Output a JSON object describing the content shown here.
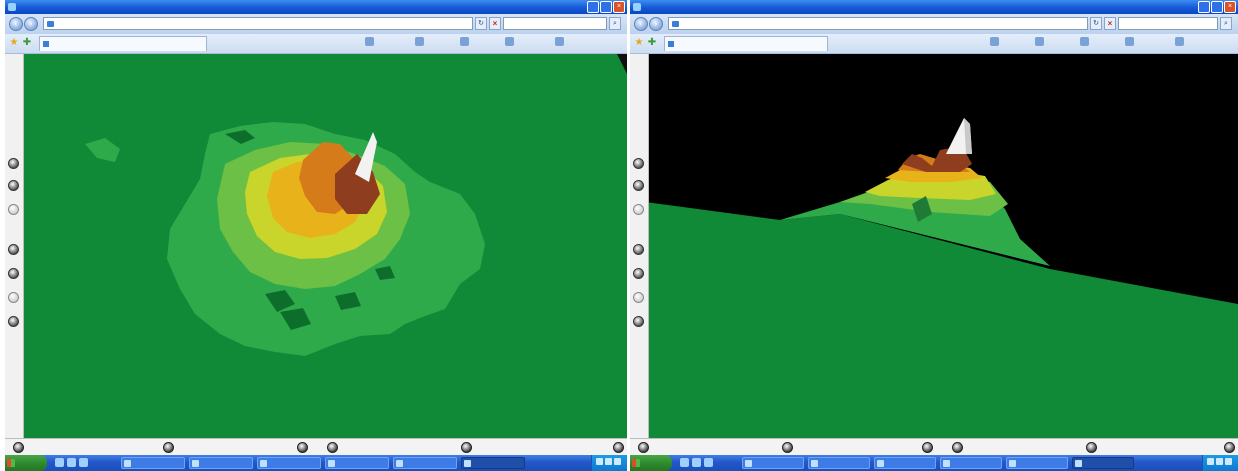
{
  "colors": {
    "terrain_base": "#118a37",
    "sky": "#000000",
    "band_1": "#2faa4a",
    "band_2": "#6cc045",
    "band_3": "#c9d52a",
    "band_4": "#e8b21b",
    "band_5": "#d67b1a",
    "peak_brown": "#8e3e1f",
    "peak_snow": "#f2f2f2",
    "xp_blue": "#245edc",
    "xp_green": "#3c9a3c"
  },
  "windows": [
    {
      "id": "left",
      "title": "",
      "address": "",
      "search_placeholder": "",
      "tab_label": "",
      "toolbar": {
        "favorites_label": "",
        "home_label": "",
        "page_label": "",
        "tools_label": ""
      },
      "view": "top-down terrain elevation view",
      "side_controls": [
        "",
        "",
        "",
        "",
        "",
        "",
        "",
        ""
      ],
      "bottom_labels": [
        "",
        "",
        "",
        ""
      ]
    },
    {
      "id": "right",
      "title": "",
      "address": "",
      "search_placeholder": "",
      "tab_label": "",
      "toolbar": {
        "favorites_label": "",
        "home_label": "",
        "page_label": "",
        "tools_label": ""
      },
      "view": "side terrain profile view",
      "side_controls": [
        "",
        "",
        "",
        "",
        "",
        "",
        "",
        ""
      ],
      "bottom_labels": [
        "",
        "",
        "",
        ""
      ]
    }
  ],
  "taskbar": {
    "start_label": "",
    "tasks_left": [
      "",
      "",
      "",
      "",
      "",
      "",
      "",
      ""
    ],
    "tasks_right": [
      "",
      "",
      "",
      "",
      "",
      "",
      "",
      ""
    ],
    "clock": ""
  },
  "icons": {
    "back": "back-arrow-icon",
    "forward": "forward-arrow-icon",
    "refresh": "refresh-icon",
    "stop": "stop-icon",
    "search": "search-icon",
    "favorites_star": "star-icon",
    "add_favorite": "add-favorite-icon",
    "home": "home-icon",
    "feeds": "feeds-icon",
    "print": "print-icon",
    "page": "page-icon",
    "tools": "tools-icon"
  }
}
